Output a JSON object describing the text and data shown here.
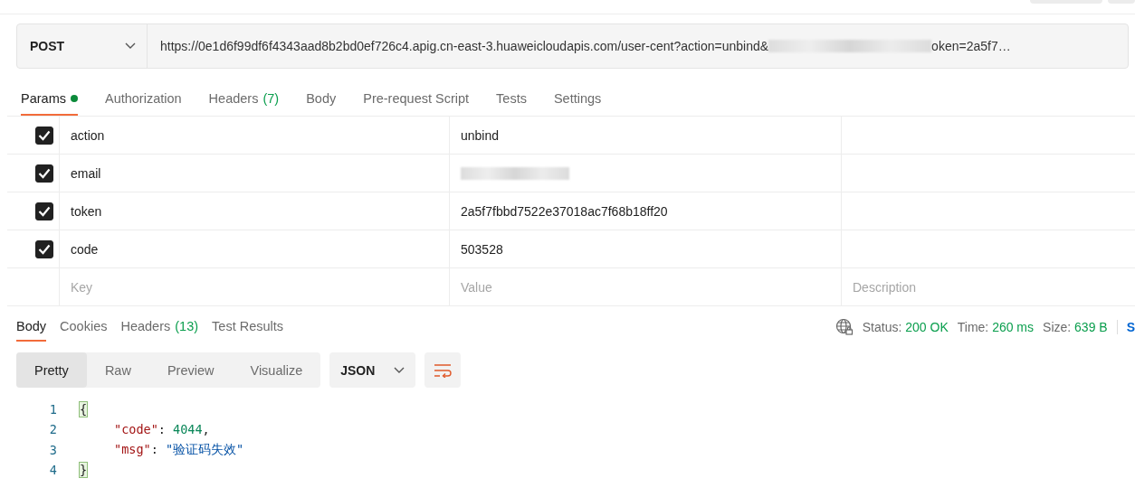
{
  "request": {
    "method": "POST",
    "url_start": "https://0e1d6f99df6f4343aad8b2bd0ef726c4.apig.cn-east-3.huaweicloudapis.com/user-cent?action=unbind&",
    "url_redacted": true,
    "url_end": "oken=2a5f7…"
  },
  "request_tabs": [
    {
      "label": "Params",
      "selected": true,
      "dot": true
    },
    {
      "label": "Authorization",
      "selected": false,
      "dot": false
    },
    {
      "label": "Headers",
      "count": "(7)",
      "selected": false,
      "dot": false
    },
    {
      "label": "Body",
      "selected": false,
      "dot": false
    },
    {
      "label": "Pre-request Script",
      "selected": false,
      "dot": false
    },
    {
      "label": "Tests",
      "selected": false,
      "dot": false
    },
    {
      "label": "Settings",
      "selected": false,
      "dot": false
    }
  ],
  "params": [
    {
      "checked": true,
      "key": "action",
      "value": "unbind",
      "redacted": false
    },
    {
      "checked": true,
      "key": "email",
      "redacted": true
    },
    {
      "checked": true,
      "key": "token",
      "value": "2a5f7fbbd7522e37018ac7f68b18ff20",
      "redacted": false
    },
    {
      "checked": true,
      "key": "code",
      "value": "503528",
      "redacted": false
    }
  ],
  "new_param": {
    "key_placeholder": "Key",
    "value_placeholder": "Value",
    "description_placeholder": "Description"
  },
  "response_tabs": [
    {
      "label": "Body",
      "selected": true
    },
    {
      "label": "Cookies",
      "selected": false
    },
    {
      "label": "Headers",
      "count": "(13)",
      "selected": false
    },
    {
      "label": "Test Results",
      "selected": false
    }
  ],
  "response_meta": [
    {
      "label": "Status:",
      "value": "200 OK"
    },
    {
      "label": "Time:",
      "value": "260 ms"
    },
    {
      "label": "Size:",
      "value": "639 B"
    }
  ],
  "save_cut": "S",
  "view_modes": [
    {
      "label": "Pretty",
      "selected": true
    },
    {
      "label": "Raw",
      "selected": false
    },
    {
      "label": "Preview",
      "selected": false
    },
    {
      "label": "Visualize",
      "selected": false
    }
  ],
  "format": "JSON",
  "code_lines": [
    {
      "number": "1",
      "tokens": [
        {
          "kind": "brace",
          "text": "{"
        }
      ]
    },
    {
      "number": "2",
      "tokens": [
        {
          "kind": "key",
          "text": "\"code\""
        },
        {
          "kind": "punct",
          "text": ": "
        },
        {
          "kind": "number",
          "text": "4044"
        },
        {
          "kind": "punct",
          "text": ","
        }
      ]
    },
    {
      "number": "3",
      "tokens": [
        {
          "kind": "key",
          "text": "\"msg\""
        },
        {
          "kind": "punct",
          "text": ": "
        },
        {
          "kind": "string",
          "text": "\"验证码失效\""
        }
      ]
    },
    {
      "number": "4",
      "tokens": [
        {
          "kind": "brace",
          "text": "}"
        }
      ]
    }
  ]
}
